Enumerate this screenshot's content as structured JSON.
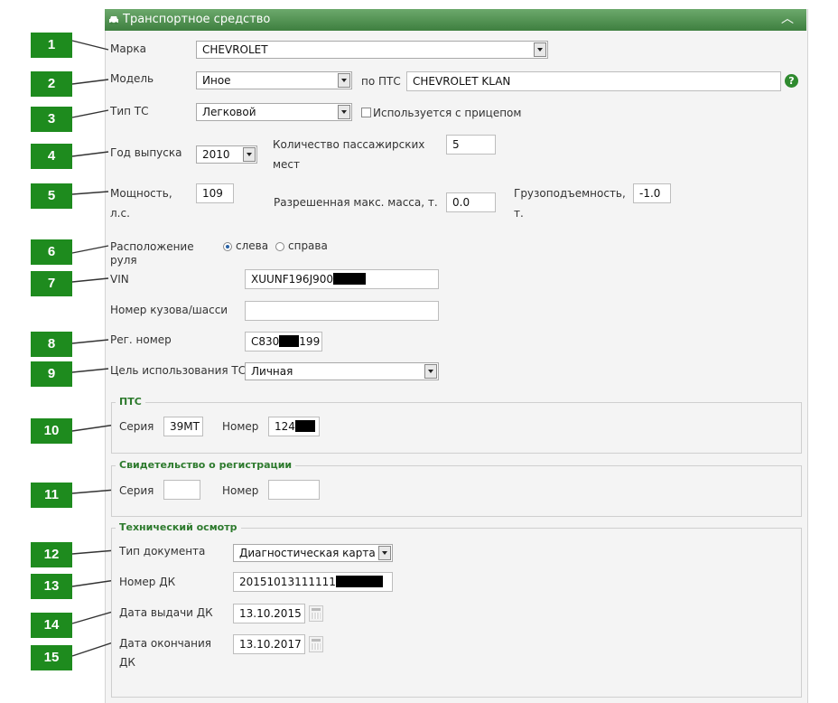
{
  "header": {
    "title": "Транспортное средство",
    "collapse_icon": "chevron-up-icon"
  },
  "badges": [
    "1",
    "2",
    "3",
    "4",
    "5",
    "6",
    "7",
    "8",
    "9",
    "10",
    "11",
    "12",
    "13",
    "14",
    "15"
  ],
  "vehicle": {
    "make": {
      "label": "Марка",
      "value": "CHEVROLET"
    },
    "model": {
      "label": "Модель",
      "value": "Иное",
      "pts_label": "по ПТС",
      "pts_value": "CHEVROLET KLAN"
    },
    "type": {
      "label": "Тип ТС",
      "value": "Легковой",
      "trailer_label": "Используется с прицепом"
    },
    "year": {
      "label": "Год выпуска",
      "value": "2010"
    },
    "seats": {
      "label_line1": "Количество пассажирских",
      "label_line2": "мест",
      "value": "5"
    },
    "power": {
      "label_line1": "Мощность,",
      "label_line2": "л.с.",
      "value": "109"
    },
    "max_mass": {
      "label": "Разрешенная макс. масса, т.",
      "value": "0.0"
    },
    "capacity": {
      "label_line1": "Грузоподъемность,",
      "label_line2": "т.",
      "value": "-1.0"
    },
    "wheel": {
      "label_line1": "Расположение",
      "label_line2": "руля",
      "left": "слева",
      "right": "справа"
    },
    "vin": {
      "label": "VIN",
      "value": "XUUNF196J900"
    },
    "body": {
      "label": "Номер кузова/шасси",
      "value": ""
    },
    "reg": {
      "label": "Рег. номер",
      "value_start": "C830",
      "value_end": "199"
    },
    "purpose": {
      "label": "Цель использования ТС",
      "value": "Личная"
    }
  },
  "pts": {
    "legend": "ПТС",
    "series_label": "Серия",
    "series_value": "39МТ",
    "number_label": "Номер",
    "number_value": "124"
  },
  "reg_cert": {
    "legend": "Свидетельство о регистрации",
    "series_label": "Серия",
    "series_value": "",
    "number_label": "Номер",
    "number_value": ""
  },
  "inspection": {
    "legend": "Технический осмотр",
    "doc_type": {
      "label": "Тип документа",
      "value": "Диагностическая карта"
    },
    "dk_number": {
      "label": "Номер ДК",
      "value": "20151013111111"
    },
    "issue_date": {
      "label": "Дата выдачи ДК",
      "value": "13.10.2015"
    },
    "end_date": {
      "label_line1": "Дата окончания",
      "label_line2": "ДК",
      "value": "13.10.2017"
    }
  },
  "colors": {
    "accent": "#1e8b1e",
    "header_top": "#6ca96c",
    "header_bottom": "#3e7f3f",
    "legend_text": "#2d7a2d",
    "panel_bg": "#f4f4f4"
  }
}
